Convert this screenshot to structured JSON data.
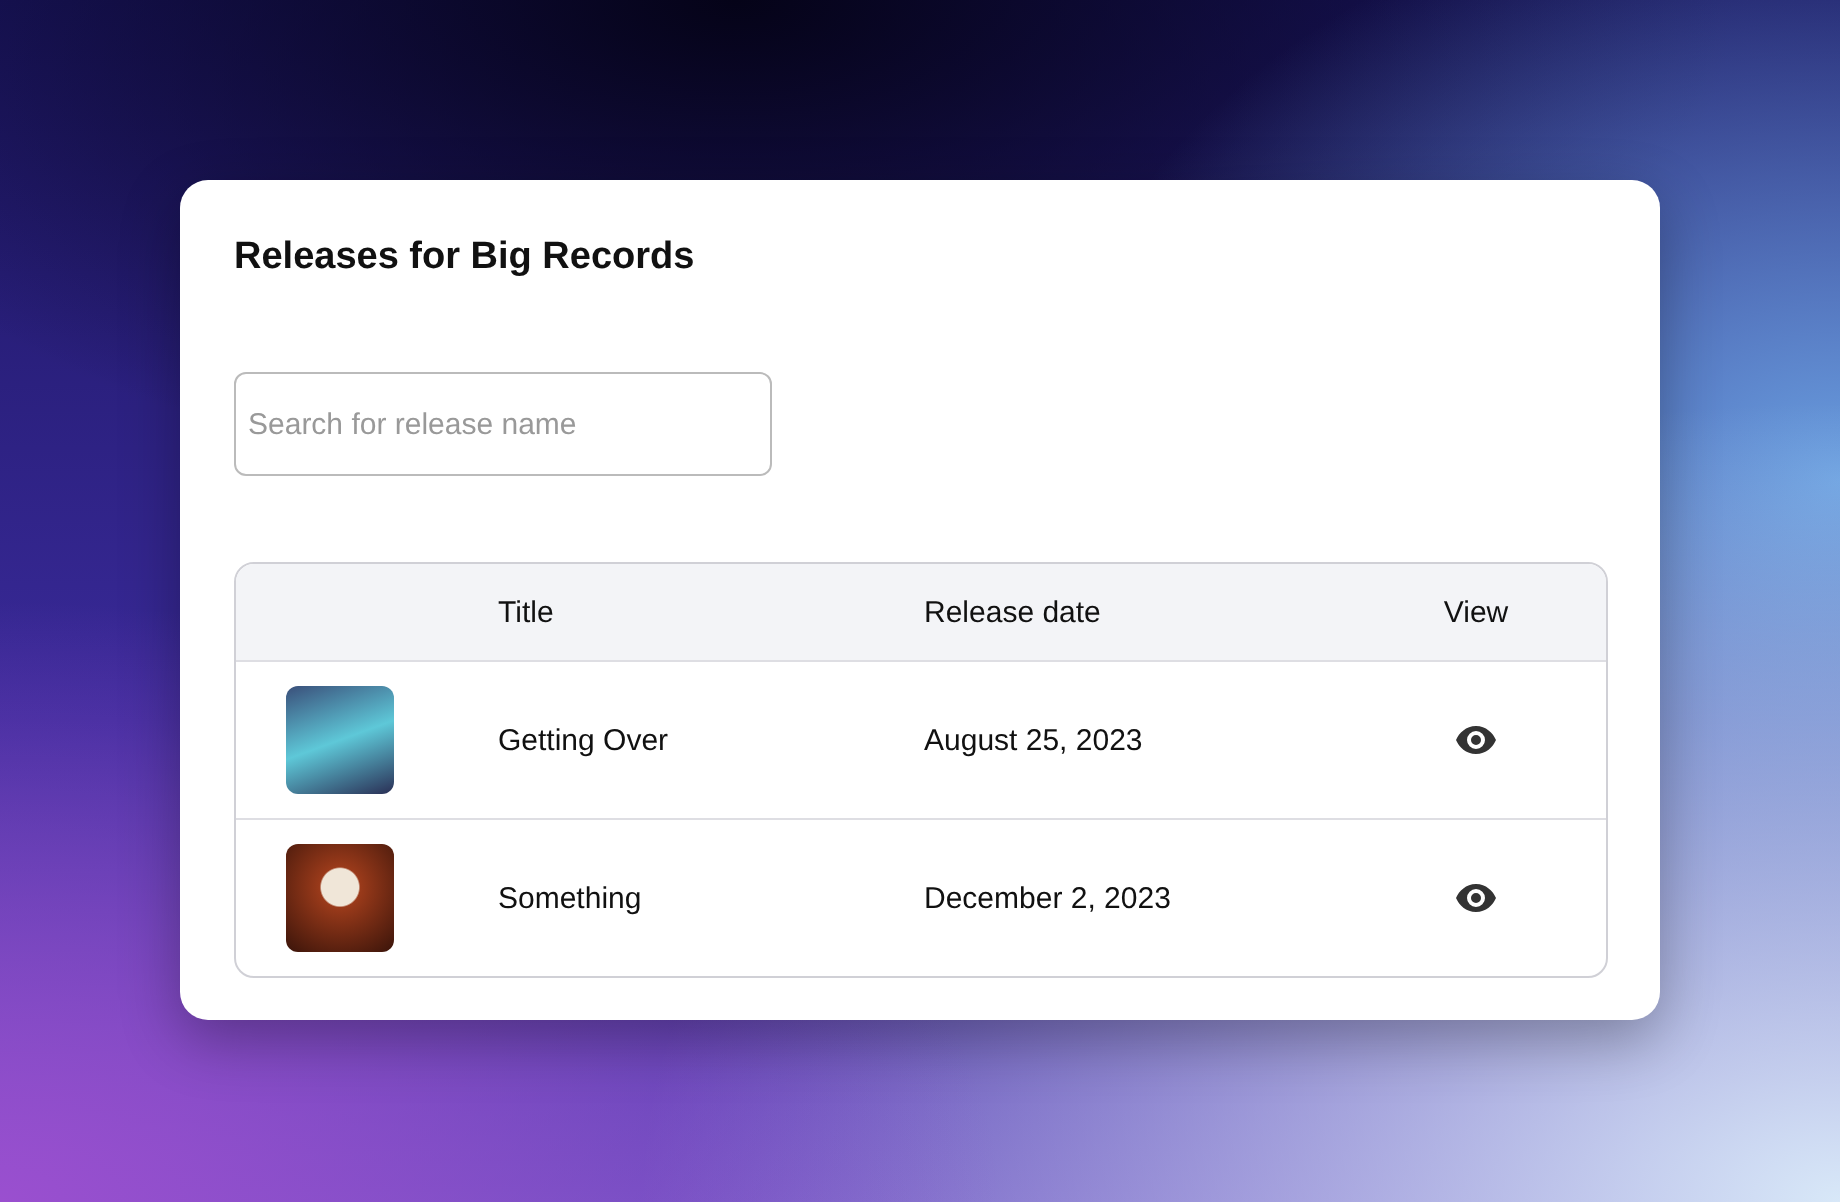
{
  "title": "Releases for Big Records",
  "search": {
    "placeholder": "Search for release name"
  },
  "table": {
    "columns": [
      "Title",
      "Release date",
      "View"
    ],
    "rows": [
      {
        "title": "Getting Over",
        "release_date": "August 25, 2023"
      },
      {
        "title": "Something",
        "release_date": "December 2, 2023"
      }
    ]
  }
}
